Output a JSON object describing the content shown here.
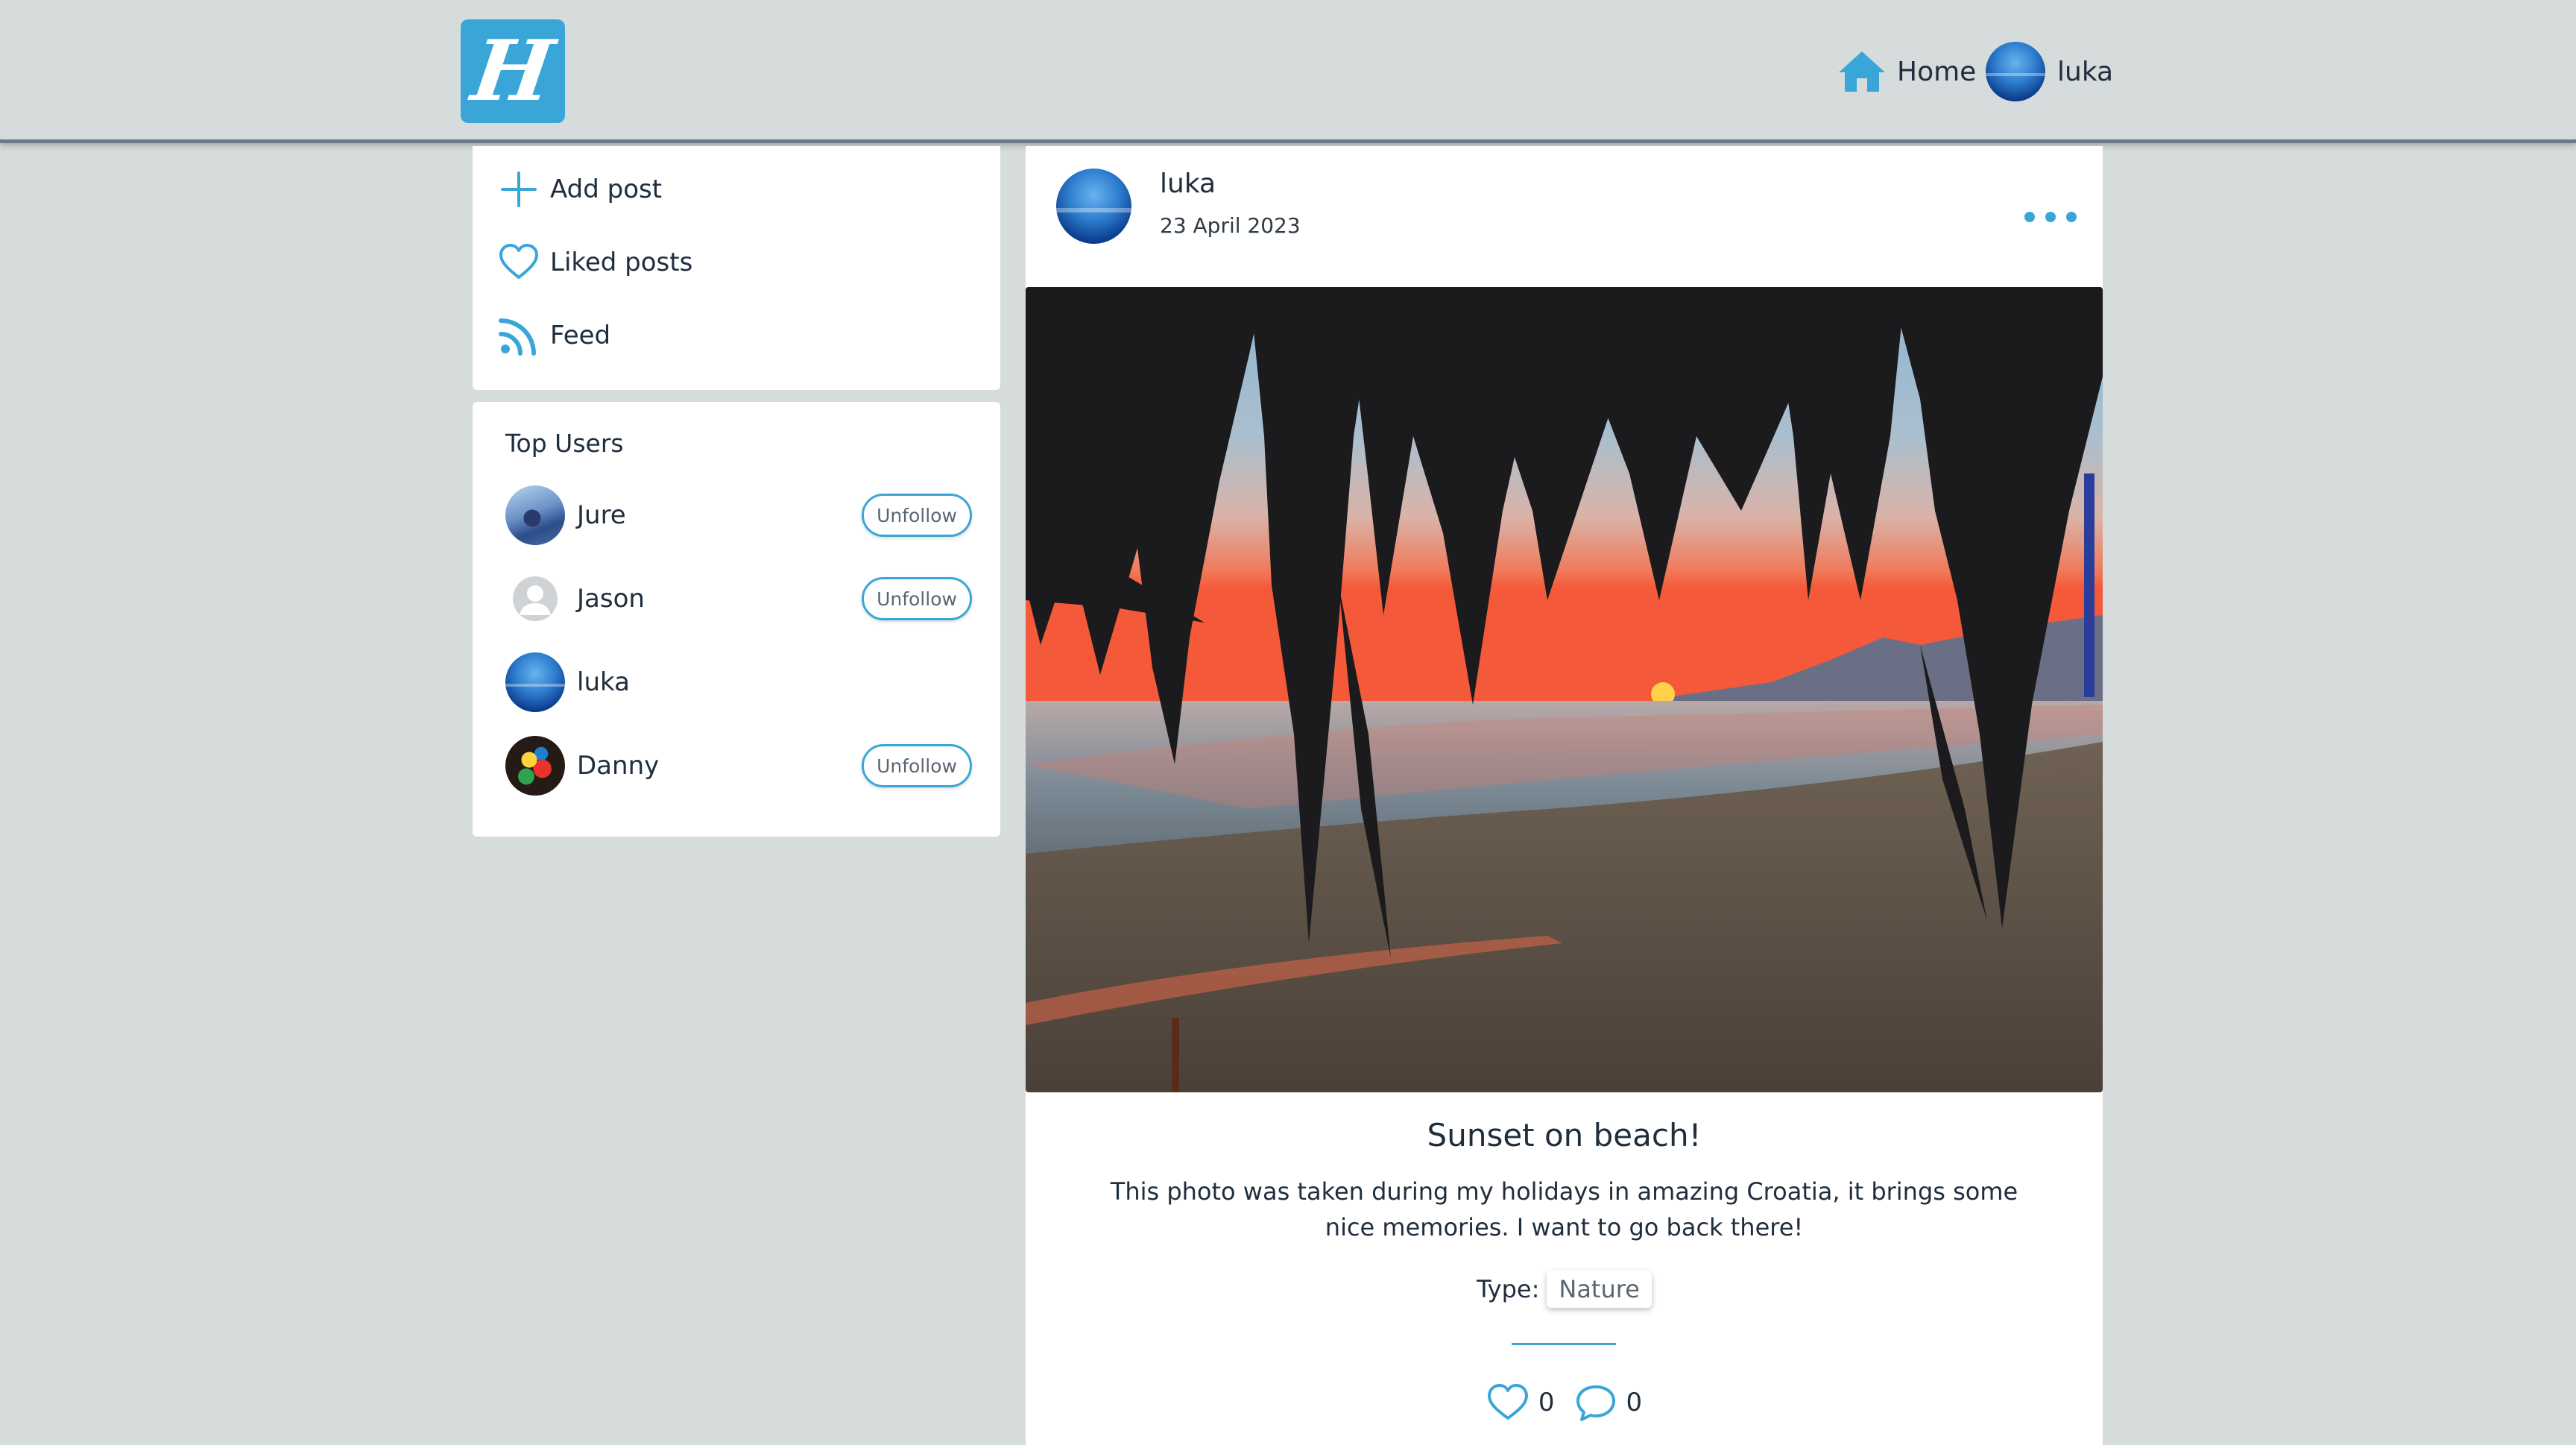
{
  "header": {
    "logo_letter": "H",
    "home_label": "Home",
    "user_name": "luka"
  },
  "sidebar": {
    "menu": [
      {
        "label": "Add post",
        "icon": "plus-icon"
      },
      {
        "label": "Liked posts",
        "icon": "heart-icon"
      },
      {
        "label": "Feed",
        "icon": "rss-feed-icon"
      }
    ],
    "top_users": {
      "title": "Top Users",
      "users": [
        {
          "name": "Jure",
          "button": "Unfollow"
        },
        {
          "name": "Jason",
          "button": "Unfollow"
        },
        {
          "name": "luka",
          "button": ""
        },
        {
          "name": "Danny",
          "button": "Unfollow"
        }
      ]
    }
  },
  "post": {
    "author": "luka",
    "date": "23 April 2023",
    "title": "Sunset on beach!",
    "description": "This photo was taken during my holidays in amazing Croatia, it brings some nice memories. I want to go back there!",
    "type_label": "Type:",
    "type_value": "Nature",
    "likes": "0",
    "comments": "0"
  },
  "colors": {
    "accent": "#3aa6d8",
    "background": "#d6dbdb",
    "card": "#ffffff",
    "text": "#1f2d3d"
  }
}
